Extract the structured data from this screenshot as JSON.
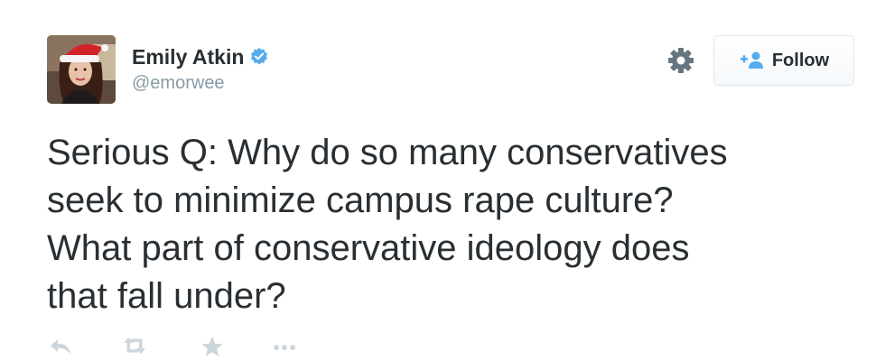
{
  "user": {
    "display_name": "Emily Atkin",
    "handle": "@emorwee",
    "verified": true,
    "avatar_icon": "profile-photo-santa-hat"
  },
  "header": {
    "gear_icon": "gear-icon",
    "follow_label": "Follow",
    "follow_icon": "add-user-icon"
  },
  "tweet": {
    "lines": [
      "Serious Q: Why do so many conservatives",
      "seek to minimize campus rape culture?",
      "What part of conservative ideology does",
      "that fall under?"
    ]
  },
  "actions": [
    {
      "name": "reply",
      "icon": "reply-icon"
    },
    {
      "name": "retweet",
      "icon": "retweet-icon"
    },
    {
      "name": "favorite",
      "icon": "star-icon"
    },
    {
      "name": "more",
      "icon": "more-icon"
    }
  ],
  "colors": {
    "text": "#292f33",
    "muted": "#8899a6",
    "verified": "#55acee",
    "action_icons": "#ccd6dd",
    "border": "#e1e8ed"
  }
}
